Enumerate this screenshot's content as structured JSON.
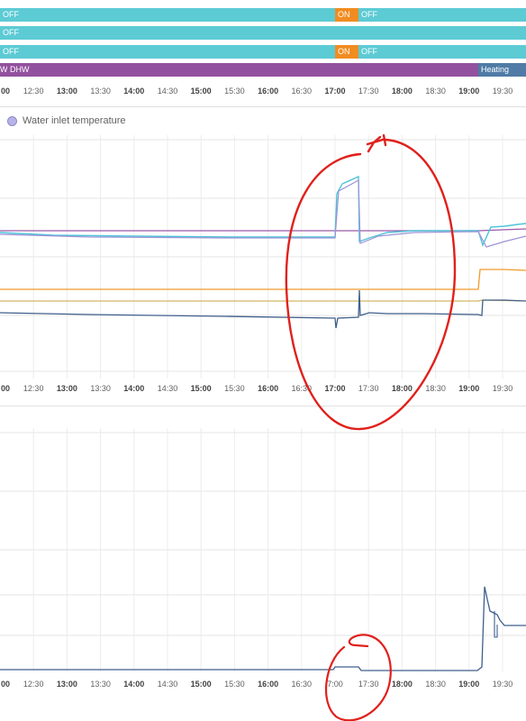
{
  "timelines": [
    {
      "segments": [
        {
          "label": "OFF",
          "color": "#5ccbd4"
        },
        {
          "label": "ON",
          "color": "#f18c21"
        },
        {
          "label": "OFF",
          "color": "#5ccbd4"
        }
      ]
    },
    {
      "segments": [
        {
          "label": "OFF",
          "color": "#5ccbd4"
        }
      ]
    },
    {
      "segments": [
        {
          "label": "OFF",
          "color": "#5ccbd4"
        },
        {
          "label": "ON",
          "color": "#f18c21"
        },
        {
          "label": "OFF",
          "color": "#5ccbd4"
        }
      ]
    },
    {
      "segments": [
        {
          "label": "W",
          "color": "#92519e"
        },
        {
          "label": "DHW",
          "color": "#92519e"
        },
        {
          "label": "Heating",
          "color": "#4f7ba6"
        }
      ]
    }
  ],
  "time_axis": [
    "00",
    "12:30",
    "13:00",
    "13:30",
    "14:00",
    "14:30",
    "15:00",
    "15:30",
    "16:00",
    "16:30",
    "17:00",
    "17:30",
    "18:00",
    "18:30",
    "19:00",
    "19:30"
  ],
  "time_axis_bottom": [
    "00",
    "12:30",
    "13:00",
    "13:30",
    "14:00",
    "14:30",
    "15:00",
    "15:30",
    "16:00",
    "16:30",
    "7:00",
    "17:30",
    "18:00",
    "18:30",
    "19:00",
    "19:30"
  ],
  "legend": {
    "label": "Water inlet temperature",
    "color": "#b8b3e6"
  },
  "colors": {
    "cyan_line": "#4fc3d9",
    "purple_line": "#9c5aa8",
    "orange_line": "#f09a2a",
    "blue_line": "#3f5f8c",
    "lavender_line": "#9e93d6",
    "gold_line": "#c8a53c",
    "annotation": "#e0201c"
  }
}
